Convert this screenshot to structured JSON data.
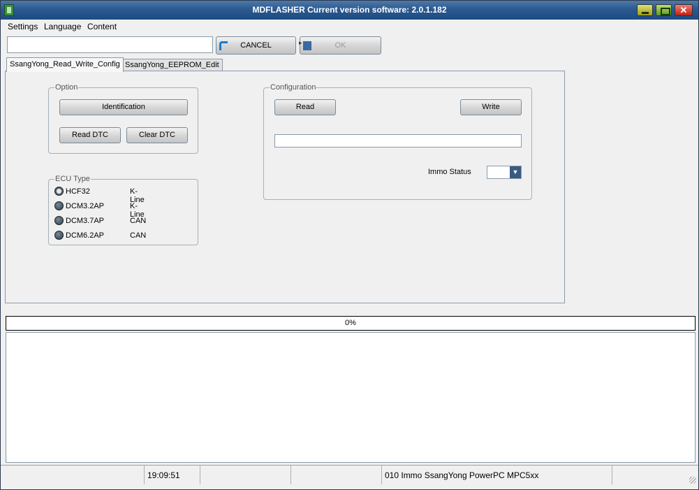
{
  "window": {
    "title": "MDFLASHER  Current version software: 2.0.1.182"
  },
  "menu": {
    "items": [
      "Settings",
      "Language",
      "Content"
    ]
  },
  "toolbar": {
    "input_value": "",
    "cancel_label": "CANCEL",
    "ok_label": "OK",
    "ok_enabled": false
  },
  "tabs": [
    {
      "label": "SsangYong_Read_Write_Config",
      "active": true
    },
    {
      "label": "SsangYong_EEPROM_Edit",
      "active": false
    }
  ],
  "option_group": {
    "title": "Option",
    "identification_label": "Identification",
    "read_dtc_label": "Read DTC",
    "clear_dtc_label": "Clear DTC"
  },
  "ecu_type": {
    "title": "ECU Type",
    "items": [
      {
        "name": "HCF32",
        "protocol": "K-Line",
        "selected": true
      },
      {
        "name": "DCM3.2AP",
        "protocol": "K-Line",
        "selected": false
      },
      {
        "name": "DCM3.7AP",
        "protocol": "CAN",
        "selected": false
      },
      {
        "name": "DCM6.2AP",
        "protocol": "CAN",
        "selected": false
      }
    ]
  },
  "configuration": {
    "title": "Configuration",
    "read_label": "Read",
    "write_label": "Write",
    "value": "",
    "immo_status_label": "Immo Status",
    "immo_status_value": ""
  },
  "progress": {
    "label": "0%",
    "value": 0
  },
  "log": {
    "lines": []
  },
  "statusbar": {
    "cells": [
      "",
      "19:09:51",
      "",
      "010 Immo SsangYong PowerPC MPC5xx",
      ""
    ]
  },
  "colors": {
    "titlebar": "#2b5a91",
    "accent": "#1a7acc"
  }
}
